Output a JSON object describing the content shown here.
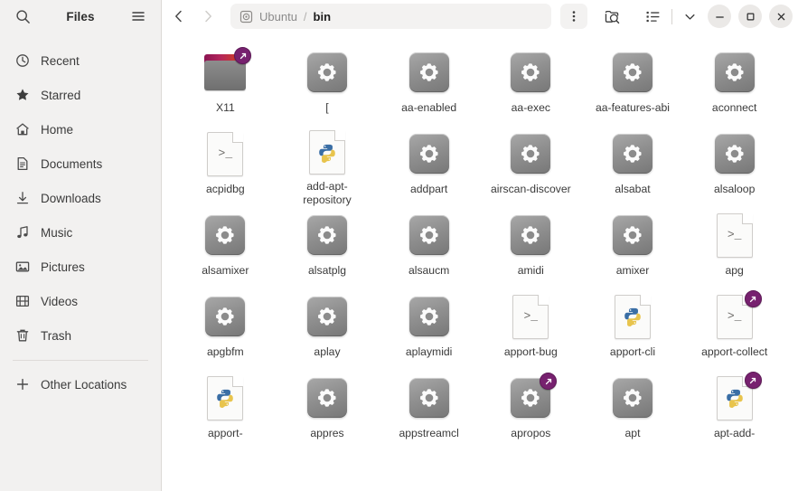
{
  "sidebar": {
    "title": "Files",
    "search_icon": "search-icon",
    "menu_icon": "hamburger-menu-icon",
    "items": [
      {
        "label": "Recent",
        "icon": "clock-icon",
        "name": "recent"
      },
      {
        "label": "Starred",
        "icon": "star-icon",
        "name": "starred"
      },
      {
        "label": "Home",
        "icon": "home-icon",
        "name": "home"
      },
      {
        "label": "Documents",
        "icon": "document-icon",
        "name": "documents"
      },
      {
        "label": "Downloads",
        "icon": "download-icon",
        "name": "downloads"
      },
      {
        "label": "Music",
        "icon": "music-note-icon",
        "name": "music"
      },
      {
        "label": "Pictures",
        "icon": "picture-icon",
        "name": "pictures"
      },
      {
        "label": "Videos",
        "icon": "video-film-icon",
        "name": "videos"
      },
      {
        "label": "Trash",
        "icon": "trash-icon",
        "name": "trash"
      }
    ],
    "other_locations": {
      "label": "Other Locations",
      "icon": "plus-icon",
      "name": "other-locations"
    }
  },
  "toolbar": {
    "back_icon": "chevron-left-icon",
    "forward_icon": "chevron-right-icon",
    "breadcrumb": {
      "drive_icon": "disk-drive-icon",
      "crumbs": [
        {
          "label": "Ubuntu",
          "active": false
        },
        {
          "label": "bin",
          "active": true
        }
      ],
      "separator": "/"
    },
    "kebab_icon": "three-dot-menu-icon",
    "search_icon": "folder-search-icon",
    "view_list_icon": "list-view-icon",
    "view_dropdown_icon": "chevron-down-icon",
    "minimize_label": "–",
    "maximize_label": "□",
    "close_label": "✕"
  },
  "colors": {
    "sidebar_bg": "#f2f1f0",
    "accent_orange": "#dd4814",
    "accent_purple": "#77216f",
    "content_bg": "#ffffff",
    "pathbar_bg": "#f3f2f1"
  },
  "files": [
    {
      "name": "X11",
      "type": "folder",
      "symlink": true
    },
    {
      "name": "[",
      "type": "executable",
      "symlink": false
    },
    {
      "name": "aa-enabled",
      "type": "executable",
      "symlink": false
    },
    {
      "name": "aa-exec",
      "type": "executable",
      "symlink": false
    },
    {
      "name": "aa-features-abi",
      "type": "executable",
      "symlink": false
    },
    {
      "name": "aconnect",
      "type": "executable",
      "symlink": false
    },
    {
      "name": "acpidbg",
      "type": "script",
      "symlink": false
    },
    {
      "name": "add-apt-repository",
      "type": "python",
      "symlink": false
    },
    {
      "name": "addpart",
      "type": "executable",
      "symlink": false
    },
    {
      "name": "airscan-discover",
      "type": "executable",
      "symlink": false
    },
    {
      "name": "alsabat",
      "type": "executable",
      "symlink": false
    },
    {
      "name": "alsaloop",
      "type": "executable",
      "symlink": false
    },
    {
      "name": "alsamixer",
      "type": "executable",
      "symlink": false
    },
    {
      "name": "alsatplg",
      "type": "executable",
      "symlink": false
    },
    {
      "name": "alsaucm",
      "type": "executable",
      "symlink": false
    },
    {
      "name": "amidi",
      "type": "executable",
      "symlink": false
    },
    {
      "name": "amixer",
      "type": "executable",
      "symlink": false
    },
    {
      "name": "apg",
      "type": "script",
      "symlink": false
    },
    {
      "name": "apgbfm",
      "type": "executable",
      "symlink": false
    },
    {
      "name": "aplay",
      "type": "executable",
      "symlink": false
    },
    {
      "name": "aplaymidi",
      "type": "executable",
      "symlink": false
    },
    {
      "name": "apport-bug",
      "type": "script",
      "symlink": false
    },
    {
      "name": "apport-cli",
      "type": "python",
      "symlink": false
    },
    {
      "name": "apport-collect",
      "type": "script",
      "symlink": true
    },
    {
      "name": "apport-",
      "type": "python",
      "symlink": false
    },
    {
      "name": "appres",
      "type": "executable",
      "symlink": false
    },
    {
      "name": "appstreamcl",
      "type": "executable",
      "symlink": false
    },
    {
      "name": "apropos",
      "type": "executable",
      "symlink": true
    },
    {
      "name": "apt",
      "type": "executable",
      "symlink": false
    },
    {
      "name": "apt-add-",
      "type": "python",
      "symlink": true
    }
  ]
}
